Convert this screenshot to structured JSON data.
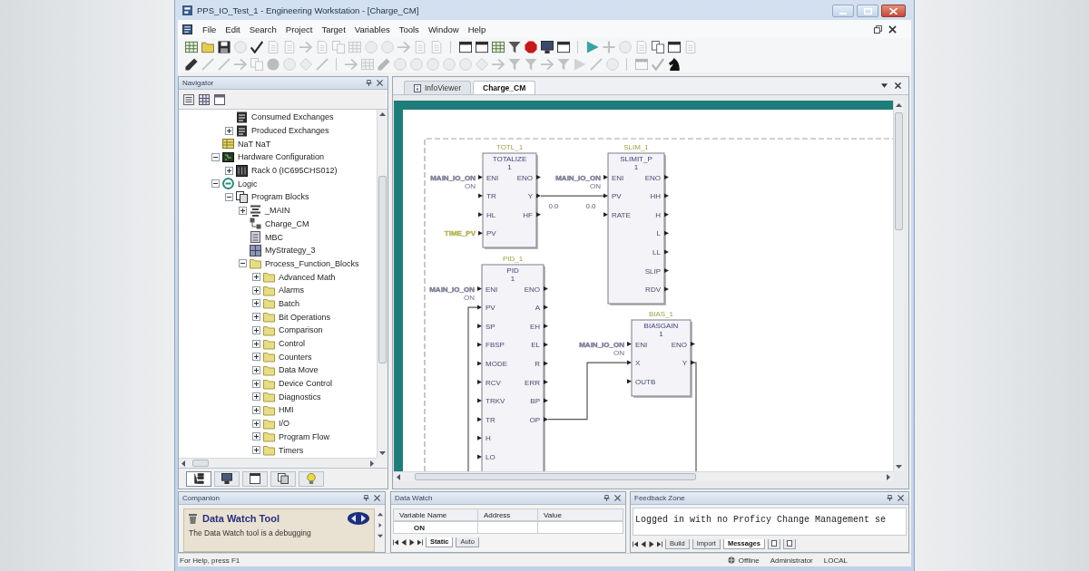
{
  "window": {
    "title": "PPS_IO_Test_1 - Engineering Workstation - [Charge_CM]"
  },
  "menu": [
    "File",
    "Edit",
    "Search",
    "Project",
    "Target",
    "Variables",
    "Tools",
    "Window",
    "Help"
  ],
  "toolbar_1": [
    {
      "disabled": false
    },
    {
      "disabled": false
    },
    {
      "disabled": false
    },
    {
      "disabled": true
    },
    {
      "disabled": false
    },
    {
      "disabled": true
    },
    {
      "disabled": true
    },
    {
      "disabled": true
    },
    {
      "disabled": true
    },
    {
      "disabled": true
    },
    {
      "disabled": true
    },
    {
      "disabled": true
    },
    {
      "disabled": true
    },
    {
      "disabled": true
    },
    {
      "disabled": true
    },
    {
      "disabled": true
    },
    {
      "disabled": false
    },
    {
      "disabled": false
    },
    {
      "disabled": false
    },
    {
      "disabled": false
    },
    {
      "disabled": false
    },
    {
      "disabled": false
    },
    {
      "disabled": false
    },
    {
      "disabled": false
    },
    {
      "disabled": true
    },
    {
      "disabled": true
    },
    {
      "disabled": true
    },
    {
      "disabled": false
    },
    {
      "disabled": false
    },
    {
      "disabled": true
    }
  ],
  "toolbar_2": [
    {
      "disabled": false
    },
    {
      "disabled": true
    },
    {
      "disabled": true
    },
    {
      "disabled": true
    },
    {
      "disabled": true
    },
    {
      "disabled": true
    },
    {
      "disabled": true
    },
    {
      "disabled": true
    },
    {
      "disabled": true
    },
    {
      "disabled": true
    },
    {
      "disabled": true
    },
    {
      "disabled": true
    },
    {
      "disabled": true
    },
    {
      "disabled": true
    },
    {
      "disabled": true
    },
    {
      "disabled": true
    },
    {
      "disabled": true
    },
    {
      "disabled": true
    },
    {
      "disabled": true
    },
    {
      "disabled": true
    },
    {
      "disabled": true
    },
    {
      "disabled": true
    },
    {
      "disabled": true
    },
    {
      "disabled": true
    },
    {
      "disabled": true
    },
    {
      "disabled": true
    },
    {
      "disabled": true
    },
    {
      "disabled": true
    },
    {
      "disabled": false
    }
  ],
  "navigator": {
    "title": "Navigator",
    "tree": [
      {
        "children": [
          {
            "label": "Consumed Exchanges",
            "kind": "exchange"
          },
          {
            "label": "Produced Exchanges",
            "kind": "exchange",
            "expanded": false
          }
        ]
      },
      {
        "label": "NaT NaT",
        "kind": "table"
      },
      {
        "label": "Hardware Configuration",
        "kind": "hardware",
        "expanded": true,
        "children": [
          {
            "label": "Rack 0 (IC695CHS012)",
            "kind": "rack",
            "expanded": false
          }
        ]
      },
      {
        "label": "Logic",
        "kind": "logic",
        "expanded": true,
        "children": [
          {
            "label": "Program Blocks",
            "kind": "blocks",
            "expanded": true,
            "children": [
              {
                "label": "_MAIN",
                "kind": "main",
                "expanded": false
              },
              {
                "label": "Charge_CM",
                "kind": "program"
              },
              {
                "label": "MBC",
                "kind": "block"
              },
              {
                "label": "MyStrategy_3",
                "kind": "strategy"
              },
              {
                "label": "Process_Function_Blocks",
                "kind": "folder",
                "expanded": true,
                "children": [
                  {
                    "label": "Advanced Math",
                    "kind": "folder",
                    "expanded": false
                  },
                  {
                    "label": "Alarms",
                    "kind": "folder",
                    "expanded": false
                  },
                  {
                    "label": "Batch",
                    "kind": "folder",
                    "expanded": false
                  },
                  {
                    "label": "Bit Operations",
                    "kind": "folder",
                    "expanded": false
                  },
                  {
                    "label": "Comparison",
                    "kind": "folder",
                    "expanded": false
                  },
                  {
                    "label": "Control",
                    "kind": "folder",
                    "expanded": false
                  },
                  {
                    "label": "Counters",
                    "kind": "folder",
                    "expanded": false
                  },
                  {
                    "label": "Data Move",
                    "kind": "folder",
                    "expanded": false
                  },
                  {
                    "label": "Device Control",
                    "kind": "folder",
                    "expanded": false
                  },
                  {
                    "label": "Diagnostics",
                    "kind": "folder",
                    "expanded": false
                  },
                  {
                    "label": "HMI",
                    "kind": "folder",
                    "expanded": false
                  },
                  {
                    "label": "I/O",
                    "kind": "folder",
                    "expanded": false
                  },
                  {
                    "label": "Program Flow",
                    "kind": "folder",
                    "expanded": false
                  },
                  {
                    "label": "Timers",
                    "kind": "folder",
                    "expanded": false
                  }
                ]
              }
            ]
          }
        ]
      }
    ],
    "tabs": [
      {
        "selected": true
      },
      {
        "selected": false
      },
      {
        "selected": false
      },
      {
        "selected": false
      },
      {
        "selected": false
      }
    ]
  },
  "editor": {
    "tabs": [
      {
        "label": "InfoViewer",
        "kind": "viewer",
        "selected": false
      },
      {
        "label": "Charge_CM",
        "kind": "document",
        "selected": true
      }
    ],
    "diagram": {
      "blocks": [
        {
          "instance": "TOTL_1",
          "type": "TOTALIZE",
          "index": "1",
          "inputs": [
            {
              "pin": "ENI",
              "signal": "MAIN_IO_ON",
              "signal_note": "ON",
              "color": "#7c7c96"
            },
            {
              "pin": "TR"
            },
            {
              "pin": "HL"
            },
            {
              "pin": "PV",
              "signal": "TIME_PV",
              "color": "#b4b45a"
            }
          ],
          "outputs": [
            "ENO",
            "Y",
            "HF"
          ]
        },
        {
          "instance": "SLIM_1",
          "type": "SLIMIT_P",
          "index": "1",
          "inputs": [
            {
              "pin": "ENI",
              "signal": "MAIN_IO_ON",
              "signal_note": "ON",
              "color": "#7c7c96"
            },
            {
              "pin": "PV"
            },
            {
              "pin": "RATE"
            }
          ],
          "outputs": [
            "ENO",
            "HH",
            "H",
            "L",
            "LL",
            "SLIP",
            "RDV"
          ]
        },
        {
          "instance": "PID_1",
          "type": "PID",
          "index": "1",
          "inputs": [
            {
              "pin": "ENI",
              "signal": "MAIN_IO_ON",
              "signal_note": "ON",
              "color": "#7c7c96"
            },
            {
              "pin": "PV"
            },
            {
              "pin": "SP"
            },
            {
              "pin": "FBSP"
            },
            {
              "pin": "MODE"
            },
            {
              "pin": "RCV"
            },
            {
              "pin": "TRKV"
            },
            {
              "pin": "TR"
            },
            {
              "pin": "H"
            },
            {
              "pin": "LO"
            }
          ],
          "outputs": [
            "ENO",
            "A",
            "EH",
            "EL",
            "R",
            "ERR",
            "BP",
            "OP"
          ]
        },
        {
          "instance": "BIAS_1",
          "type": "BIASGAIN",
          "index": "1",
          "inputs": [
            {
              "pin": "ENI",
              "signal": "MAIN_IO_ON",
              "signal_note": "ON",
              "color": "#7c7c96"
            },
            {
              "pin": "X"
            },
            {
              "pin": "OUTB"
            }
          ],
          "outputs": [
            "ENO",
            "Y"
          ]
        }
      ],
      "wire_labels": [
        "0.0",
        "0.0"
      ]
    }
  },
  "companion": {
    "title": "Companion",
    "topic": "Data Watch Tool",
    "text": "The Data Watch tool is a debugging"
  },
  "data_watch": {
    "title": "Data Watch",
    "columns": [
      "Variable Name",
      "Address",
      "Value"
    ],
    "rows": [
      [
        "ON"
      ]
    ],
    "tabs": [
      {
        "label": "Static",
        "selected": true
      },
      {
        "label": "Auto",
        "selected": false
      }
    ]
  },
  "feedback_zone": {
    "title": "Feedback Zone",
    "text": "Logged in with no Proficy Change Management se",
    "tabs": [
      {
        "label": "Build",
        "selected": false
      },
      {
        "label": "Import",
        "selected": false
      },
      {
        "label": "Messages",
        "selected": true
      },
      {
        "selected": false
      },
      {
        "selected": false
      }
    ]
  },
  "status_bar": {
    "hint": "For Help, press F1",
    "connection": "Offline",
    "user": "Administrator",
    "location": "LOCAL"
  }
}
